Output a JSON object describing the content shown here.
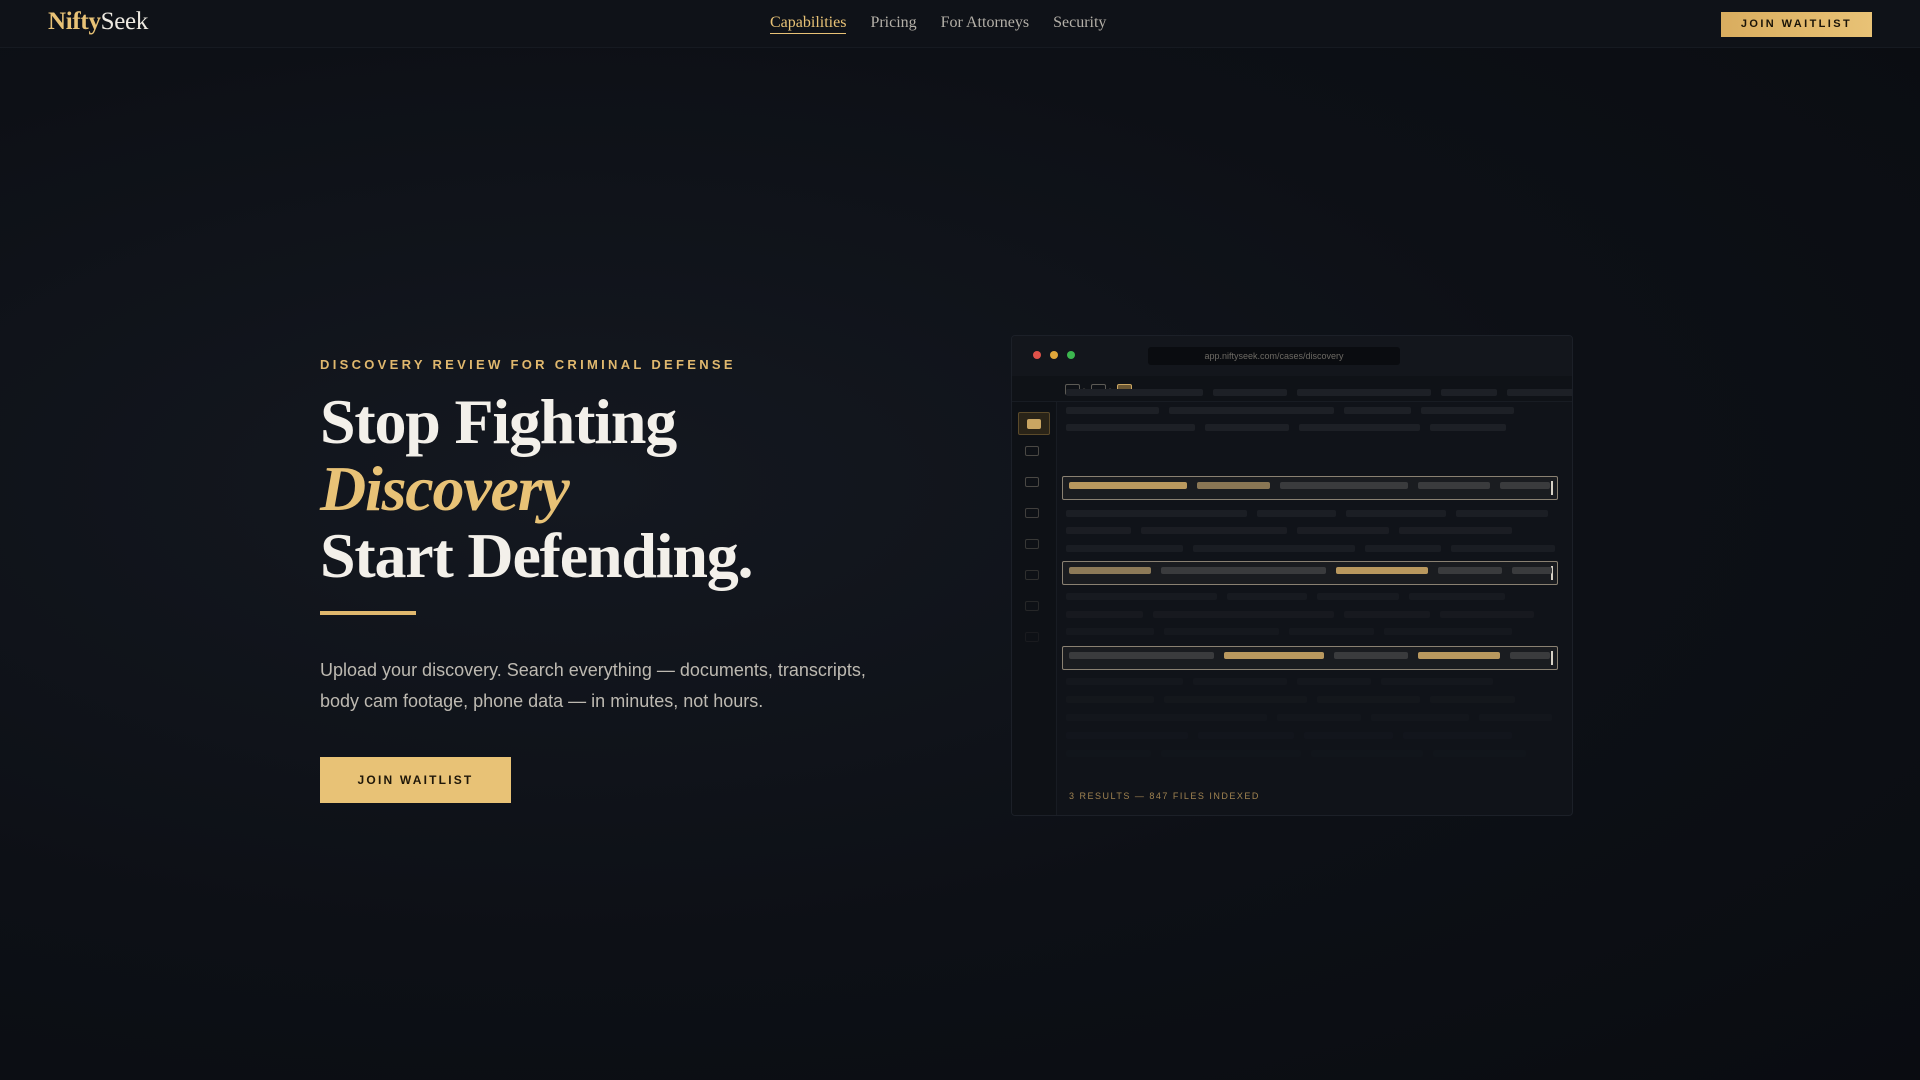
{
  "nav": {
    "logo_part1": "Nifty",
    "logo_part2": "Seek",
    "links": [
      {
        "label": "Capabilities",
        "active": true
      },
      {
        "label": "Pricing",
        "active": false
      },
      {
        "label": "For Attorneys",
        "active": false
      },
      {
        "label": "Security",
        "active": false
      }
    ],
    "cta_label": "JOIN WAITLIST"
  },
  "hero": {
    "eyebrow": "DISCOVERY REVIEW FOR CRIMINAL DEFENSE",
    "headline_line1": "Stop Fighting",
    "headline_line2": "Discovery",
    "headline_line3": "Start Defending.",
    "description": "Upload your discovery. Search everything — documents, transcripts, body cam footage, phone data — in minutes, not hours.",
    "cta_label": "JOIN WAITLIST"
  },
  "app_preview": {
    "url": "app.niftyseek.com/cases/discovery",
    "status": "3 RESULTS — 847 FILES INDEXED",
    "breadcrumb_separators": [
      ">",
      ">"
    ],
    "window_dots": [
      "#e0524a",
      "#e0a73a",
      "#3cb74f"
    ]
  },
  "colors": {
    "accent": "#e8c276",
    "background": "#0d1016",
    "text": "#f3f0ea"
  },
  "icons": [
    "folder-icon",
    "window-close-dot",
    "window-minimize-dot",
    "window-maximize-dot"
  ]
}
